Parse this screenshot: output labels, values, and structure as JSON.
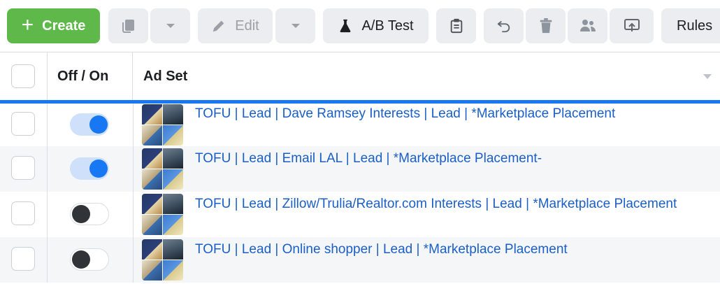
{
  "toolbar": {
    "create_label": "Create",
    "edit_label": "Edit",
    "ab_test_label": "A/B Test",
    "rules_label": "Rules"
  },
  "table": {
    "columns": {
      "toggle": "Off / On",
      "adset": "Ad Set"
    },
    "rows": [
      {
        "enabled": true,
        "name": "TOFU | Lead | Dave Ramsey Interests | Lead | *Marketplace Placement"
      },
      {
        "enabled": true,
        "name": "TOFU | Lead | Email LAL | Lead | *Marketplace Placement-"
      },
      {
        "enabled": false,
        "name": "TOFU | Lead | Zillow/Trulia/Realtor.com Interests | Lead | *Marketplace Placement"
      },
      {
        "enabled": false,
        "name": "TOFU | Lead | Online shopper | Lead | *Marketplace Placement"
      }
    ]
  },
  "colors": {
    "create": "#5fb84a",
    "accent": "#1877f2",
    "link": "#1a5fc7"
  },
  "icons": [
    "plus-icon",
    "duplicate-icon",
    "chevron-down-icon",
    "pencil-icon",
    "beaker-icon",
    "clipboard-icon",
    "undo-icon",
    "trash-icon",
    "people-icon",
    "export-icon",
    "sort-caret-icon"
  ]
}
